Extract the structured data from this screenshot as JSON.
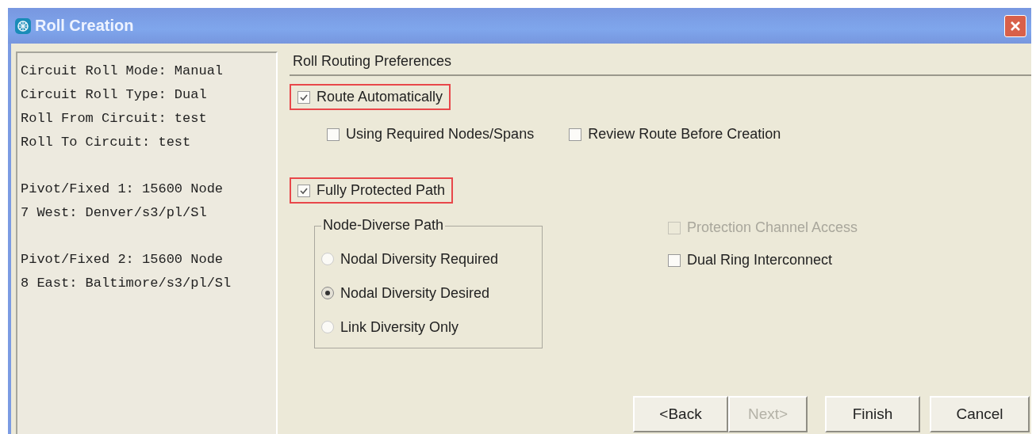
{
  "window": {
    "title": "Roll Creation"
  },
  "summary": [
    [
      "Circuit Roll Mode: Manual",
      "Circuit Roll Type: Dual",
      "Roll From Circuit: test",
      "Roll To Circuit: test"
    ],
    [
      "Pivot/Fixed 1: 15600 Node",
      "7 West: Denver/s3/pl/Sl"
    ],
    [
      "Pivot/Fixed 2: 15600 Node",
      "8 East: Baltimore/s3/pl/Sl"
    ]
  ],
  "preferences": {
    "title": "Roll Routing Preferences",
    "route_automatically": {
      "label": "Route Automatically",
      "checked": true,
      "highlighted": true
    },
    "route_options": [
      {
        "label": "Using Required Nodes/Spans",
        "checked": false
      },
      {
        "label": "Review Route Before Creation",
        "checked": false
      }
    ],
    "fully_protected_path": {
      "label": "Fully Protected Path",
      "checked": true,
      "highlighted": true
    },
    "node_diverse_path": {
      "title": "Node-Diverse Path",
      "options": [
        {
          "label": "Nodal Diversity Required",
          "selected": false
        },
        {
          "label": "Nodal Diversity Desired",
          "selected": true
        },
        {
          "label": "Link Diversity Only",
          "selected": false
        }
      ]
    },
    "protection_options": [
      {
        "label": "Protection Channel Access",
        "checked": false,
        "disabled": true
      },
      {
        "label": "Dual Ring Interconnect",
        "checked": false,
        "disabled": false
      }
    ]
  },
  "buttons": [
    {
      "label": "<Back",
      "disabled": false
    },
    {
      "label": "Next>",
      "disabled": true
    },
    {
      "label": "Finish",
      "disabled": false
    },
    {
      "label": "Cancel",
      "disabled": false
    }
  ]
}
